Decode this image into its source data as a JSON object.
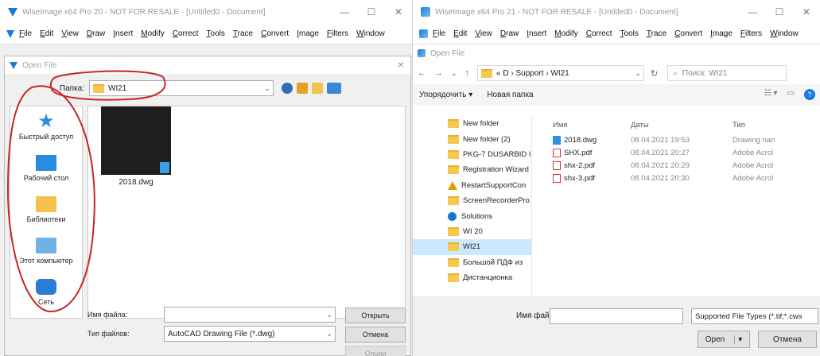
{
  "left": {
    "title": "WiseImage x64 Pro 20 - NOT FOR RESALE - [Untitled0 - Document]",
    "menu": [
      "File",
      "Edit",
      "View",
      "Draw",
      "Insert",
      "Modify",
      "Correct",
      "Tools",
      "Trace",
      "Convert",
      "Image",
      "Filters",
      "Window"
    ],
    "dialog_title": "Open File",
    "lookin_label": "Папка:",
    "lookin_value": "WI21",
    "places": [
      "Быстрый доступ",
      "Рабочий стол",
      "Библиотеки",
      "Этот компьютер",
      "Сеть"
    ],
    "file_name": "2018.dwg",
    "filename_label": "Имя файла:",
    "filetype_label": "Тип файлов:",
    "filetype_value": "AutoCAD Drawing File (*.dwg)",
    "open_btn": "Открыть",
    "cancel_btn": "Отмена",
    "options_btn": "Опции"
  },
  "right": {
    "title": "WiseImage x64 Pro 21 - NOT FOR RESALE - [Untitled0 - Document]",
    "menu": [
      "File",
      "Edit",
      "View",
      "Draw",
      "Insert",
      "Modify",
      "Correct",
      "Tools",
      "Trace",
      "Convert",
      "Image",
      "Filters",
      "Window"
    ],
    "dialog_title": "Open File",
    "path": "« D  ›  Support  ›  WI21",
    "search_placeholder": "Поиск: WI21",
    "organize": "Упорядочить ▾",
    "new_folder": "Новая папка",
    "tree": [
      "New folder",
      "New folder (2)",
      "PKG-7 DUSARBID II",
      "Registration Wizard",
      "RestartSupportCon",
      "ScreenRecorderPro",
      "Solutions",
      "WI 20",
      "WI21",
      "Большой ПДФ из",
      "Дистанционка"
    ],
    "col_name": "Имя",
    "col_date": "Даты",
    "col_type": "Тип",
    "files": [
      {
        "name": "2018.dwg",
        "date": "08.04.2021 19:53",
        "type": "Drawing nan"
      },
      {
        "name": "SHX.pdf",
        "date": "08.04.2021 20:27",
        "type": "Adobe Acrol"
      },
      {
        "name": "shx-2.pdf",
        "date": "08.04.2021 20:29",
        "type": "Adobe Acrol"
      },
      {
        "name": "shx-3.pdf",
        "date": "08.04.2021 20:30",
        "type": "Adobe Acrol"
      }
    ],
    "filename_label": "Имя файла:",
    "filetype_value": "Supported File Types (*.tif;*.cws",
    "open_btn": "Open",
    "cancel_btn": "Отмена"
  }
}
